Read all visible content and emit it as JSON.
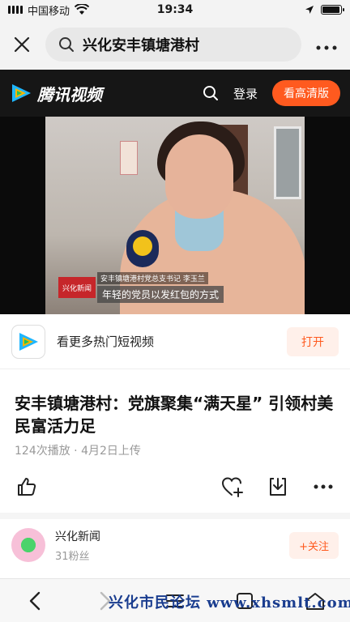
{
  "status_bar": {
    "carrier": "中国移动",
    "time": "19:34",
    "battery_level": 0.95
  },
  "search": {
    "query": "兴化安丰镇塘港村"
  },
  "tv_header": {
    "logo_text": "腾讯视频",
    "login_label": "登录",
    "hd_label": "看高清版"
  },
  "video": {
    "caption_top": "安丰镇塘港村党总支书记 李玉兰",
    "caption_main": "年轻的党员以发红包的方式",
    "station_logo": "兴化新闻"
  },
  "promo": {
    "text": "看更多热门短视频",
    "open_label": "打开"
  },
  "article": {
    "title": "安丰镇塘港村：党旗聚集“满天星” 引领村美民富活力足",
    "meta": "124次播放 · 4月2日上传"
  },
  "author": {
    "name": "兴化新闻",
    "fans": "31粉丝",
    "follow_label": "+关注"
  },
  "watermark": {
    "text": "兴化市民论坛  www.xhsmlt.com"
  },
  "colors": {
    "accent": "#ff5a1f",
    "header_bg": "#161616"
  }
}
